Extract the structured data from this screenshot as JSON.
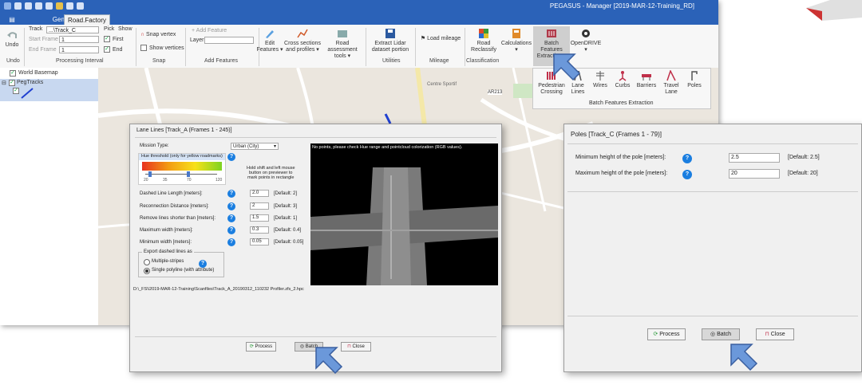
{
  "window": {
    "title": "PEGASUS - Manager [2019-MAR-12-Training_RD]"
  },
  "tabs": [
    {
      "label": "General"
    },
    {
      "label": "Road.Factory"
    }
  ],
  "ribbon": {
    "undo": {
      "label": "Undo",
      "group": "Undo"
    },
    "processing": {
      "track_label": "Track",
      "track_value": "...\\Track_C",
      "pick_label": "Pick",
      "show_label": "Show",
      "start_frame_label": "Start Frame",
      "start_frame_value": "1",
      "end_frame_label": "End Frame",
      "end_frame_value": "1",
      "first_label": "First",
      "end_label": "End",
      "group": "Processing Interval"
    },
    "snap": {
      "snap_vertex": "Snap vertex",
      "show_vertices": "Show vertices",
      "group": "Snap"
    },
    "add_features": {
      "add_feature": "Add Feature",
      "layer_label": "Layer",
      "group": "Add Features"
    },
    "buttons": [
      {
        "label": "Edit\nFeatures ▾"
      },
      {
        "label": "Cross sections\nand profiles ▾"
      },
      {
        "label": "Road assessment\ntools ▾"
      },
      {
        "label": "Extract Lidar\ndataset portion"
      },
      {
        "label": "Load mileage"
      },
      {
        "label": "Road\nReclassify"
      },
      {
        "label": "Calculations\n▾"
      },
      {
        "label": "Batch Features\nExtraction ▾"
      },
      {
        "label": "OpenDRIVE\n▾"
      }
    ],
    "group_labels": {
      "utilities": "Utilities",
      "mileage": "Mileage",
      "classification": "Classification"
    }
  },
  "layers": {
    "basemap": "World Basemap",
    "tracks": "PegTracks"
  },
  "batch_panel": {
    "items": [
      "Pedestrian\nCrossing",
      "Lane\nLines",
      "Wires",
      "Curbs",
      "Barriers",
      "Travel\nLane",
      "Poles"
    ],
    "caption": "Batch Features Extraction"
  },
  "lane_dialog": {
    "title": "Lane Lines  [Track_A (Frames 1 - 245)]",
    "mission_type_label": "Mission Type:",
    "mission_type_value": "Urban (City)",
    "hue_label": "Hue threshold (only for yellow roadmarks)",
    "hue_ticks": [
      "20",
      "35",
      "70",
      "120"
    ],
    "hint": "Hold shift and left mouse\nbutton on previewer to\nmark points in rectangle",
    "params": [
      {
        "label": "Dashed Line Length [meters]:",
        "value": "2.0",
        "default": "[Default: 2]"
      },
      {
        "label": "Reconnection Distance [meters]:",
        "value": "2",
        "default": "[Default: 3]"
      },
      {
        "label": "Remove lines shorter than [meters]:",
        "value": "1.5",
        "default": "[Default: 1]"
      },
      {
        "label": "Maximum width [meters]:",
        "value": "0.3",
        "default": "[Default: 0.4]"
      },
      {
        "label": "Minimum width [meters]:",
        "value": "0.05",
        "default": "[Default: 0.05]"
      }
    ],
    "export_label": "Export dashed lines as",
    "export_options": [
      "Multiple-stripes",
      "Single polyline (with attribute)"
    ],
    "preview_message": "No points, please check Hue range and pointcloud colorization (RGB values).",
    "path": "D:\\_FS\\\\2019-MAR-12-Training\\Scanfiles\\Track_A_20190312_110232 Profiler.zfs_2.hpc",
    "process": "Process",
    "batch": "Batch",
    "close": "Close"
  },
  "poles_dialog": {
    "title": "Poles  [Track_C (Frames 1 - 79)]",
    "params": [
      {
        "label": "Minimum height of the pole [meters]:",
        "value": "2.5",
        "default": "[Default: 2.5]"
      },
      {
        "label": "Maximum height of the pole [meters]:",
        "value": "20",
        "default": "[Default: 20]"
      }
    ],
    "process": "Process",
    "batch": "Batch",
    "close": "Close"
  },
  "map_labels": [
    "AR213",
    "Centre Sportif"
  ],
  "colors": {
    "titlebar": "#2b62b8",
    "accent_arrow": "#5b8fd6",
    "help": "#1a7ee0"
  }
}
